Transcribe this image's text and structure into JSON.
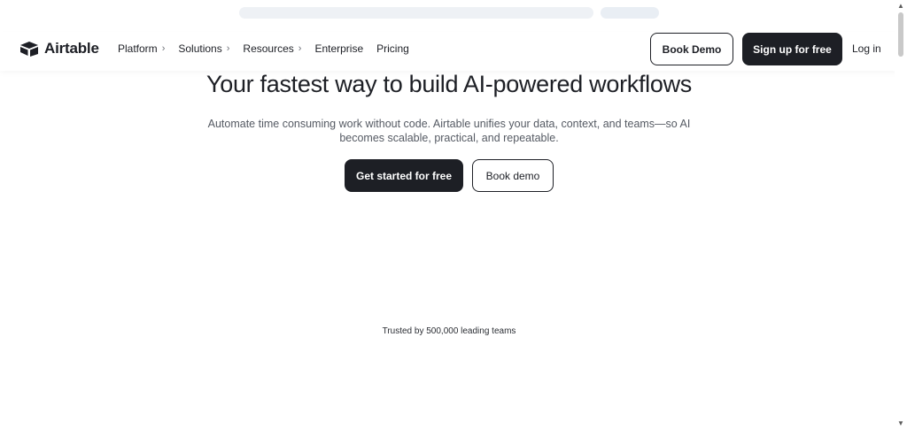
{
  "nav": {
    "brand": "Airtable",
    "items": [
      {
        "label": "Platform",
        "chevron": "›"
      },
      {
        "label": "Solutions",
        "chevron": "›"
      },
      {
        "label": "Resources",
        "chevron": "›"
      },
      {
        "label": "Enterprise"
      },
      {
        "label": "Pricing"
      }
    ],
    "book_demo": "Book Demo",
    "signup": "Sign up for free",
    "login": "Log in"
  },
  "hero": {
    "title": "Your fastest way to build AI-powered workflows",
    "subtitle_line1": "Automate time consuming work without code. Airtable unifies your data, context, and teams—so AI",
    "subtitle_line2": "becomes scalable, practical, and repeatable.",
    "cta_primary": "Get started for free",
    "cta_secondary": "Book demo"
  },
  "trusted": "Trusted by 500,000 leading teams",
  "scrollbar": {
    "up": "▲",
    "down": "▼"
  },
  "colors": {
    "text": "#1d1f25",
    "dark_button": "#1d1f25",
    "muted": "#555a63"
  }
}
